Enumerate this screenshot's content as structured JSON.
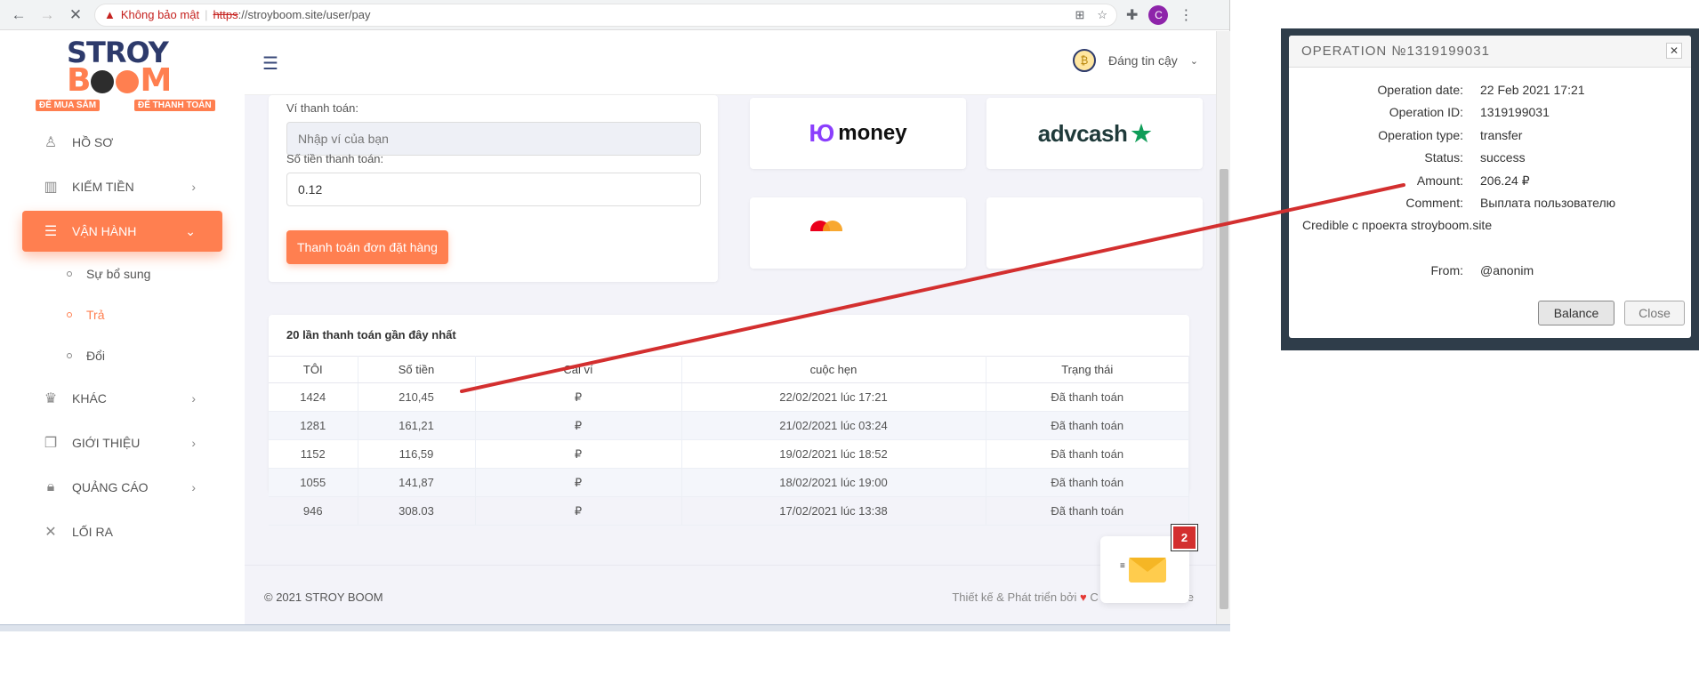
{
  "browser": {
    "insecure_label": "Không bảo mật",
    "url_scheme": "https",
    "url_rest": "://stroyboom.site/user/pay",
    "profile_initial": "C"
  },
  "logo": {
    "stroy": "STROY",
    "boom_b": "B",
    "boom_m": "M",
    "tag_left": "ĐỂ MUA SẮM",
    "tag_right": "ĐỂ THANH TOÁN"
  },
  "sidebar": {
    "items": [
      {
        "label": "HỒ SƠ",
        "icon": "user-icon"
      },
      {
        "label": "KIẾM TIỀN",
        "icon": "chart-icon"
      },
      {
        "label": "VẬN HÀNH",
        "icon": "database-icon"
      },
      {
        "label": "KHÁC",
        "icon": "crown-icon"
      },
      {
        "label": "GIỚI THIỆU",
        "icon": "copy-icon"
      },
      {
        "label": "QUẢNG CÁO",
        "icon": "lock-icon"
      },
      {
        "label": "LỐI RA",
        "icon": "close-icon"
      }
    ],
    "submenu": [
      {
        "label": "Sự bổ sung"
      },
      {
        "label": "Trả"
      },
      {
        "label": "Đổi"
      }
    ]
  },
  "topbar": {
    "user_label": "Đáng tin cậy"
  },
  "payform": {
    "wallet_label": "Ví thanh toán:",
    "wallet_placeholder": "Nhập ví của bạn",
    "amount_label": "Số tiền thanh toán:",
    "amount_value": "0.12",
    "submit_label": "Thanh toán đơn đặt hàng"
  },
  "methods": {
    "money_mark": "Ю",
    "money_text": "money",
    "advcash_text": "advcash",
    "advcash_star": "★"
  },
  "history": {
    "title": "20 lần thanh toán gần đây nhất",
    "columns": [
      "TÔI",
      "Số tiền",
      "Cái ví",
      "cuộc hẹn",
      "Trạng thái"
    ],
    "rows": [
      [
        "1424",
        "210,45",
        "₽",
        "22/02/2021 lúc 17:21",
        "Đã thanh toán"
      ],
      [
        "1281",
        "161,21",
        "₽",
        "21/02/2021 lúc 03:24",
        "Đã thanh toán"
      ],
      [
        "1152",
        "116,59",
        "₽",
        "19/02/2021 lúc 18:52",
        "Đã thanh toán"
      ],
      [
        "1055",
        "141,87",
        "₽",
        "18/02/2021 lúc 19:00",
        "Đã thanh toán"
      ],
      [
        "946",
        "308.03",
        "₽",
        "17/02/2021 lúc 13:38",
        "Đã thanh toán"
      ]
    ]
  },
  "footer": {
    "copyright": "© 2021 STROY BOOM",
    "credit_prefix": "Thiết kế & Phát triển bởi",
    "heart": "♥",
    "credit_tail": "C",
    "credit_end": "e"
  },
  "mail": {
    "badge_count": "2"
  },
  "dialog": {
    "title": "OPERATION №1319199031",
    "close_glyph": "✕",
    "fields": [
      {
        "key": "Operation date:",
        "value": "22 Feb 2021 17:21"
      },
      {
        "key": "Operation ID:",
        "value": "1319199031"
      },
      {
        "key": "Operation type:",
        "value": "transfer"
      },
      {
        "key": "Status:",
        "value": "success"
      },
      {
        "key": "Amount:",
        "value": "206.24 ₽"
      },
      {
        "key": "Comment:",
        "value": "Выплата пользователю"
      }
    ],
    "comment_continued": "Credible с проекта stroyboom.site",
    "from_key": "From:",
    "from_value": "@anonim",
    "balance_label": "Balance",
    "close_label": "Close"
  },
  "colors": {
    "accent": "#ff7f50",
    "annotation_line": "#d32f2f",
    "brand_navy": "#2d3a6b"
  }
}
